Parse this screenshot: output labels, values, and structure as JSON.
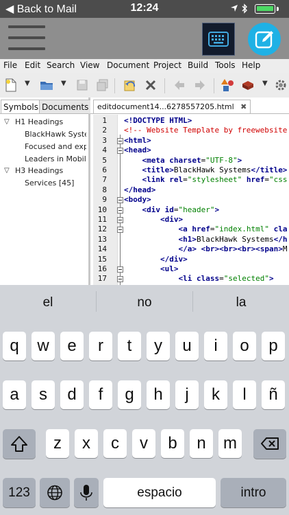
{
  "status": {
    "back": "◀ Back to Mail",
    "time": "12:24"
  },
  "menu": [
    "File",
    "Edit",
    "Search",
    "View",
    "Document",
    "Project",
    "Build",
    "Tools",
    "Help"
  ],
  "sidebar": {
    "tabs": [
      "Symbols",
      "Documents"
    ],
    "tree": [
      {
        "label": "H1 Headings",
        "group": true
      },
      {
        "label": "BlackHawk System",
        "group": false
      },
      {
        "label": "Focused and expe",
        "group": false
      },
      {
        "label": "Leaders in Mobile",
        "group": false
      },
      {
        "label": "H3 Headings",
        "group": true
      },
      {
        "label": "Services [45]",
        "group": false
      }
    ]
  },
  "editor": {
    "tab_title": "editdocument14...6278557205.html",
    "line_numbers": [
      "1",
      "2",
      "3",
      "4",
      "5",
      "6",
      "7",
      "8",
      "9",
      "10",
      "11",
      "12",
      "13",
      "14",
      "15",
      "16",
      "17"
    ],
    "code": [
      [
        [
          "tag",
          "<!DOCTYPE HTML>"
        ]
      ],
      [
        [
          "cmt",
          "<!-- Website Template by freewebsite"
        ]
      ],
      [
        [
          "tag",
          "<html>"
        ]
      ],
      [
        [
          "tag",
          "<head>"
        ]
      ],
      [
        [
          "txt",
          "    "
        ],
        [
          "tag",
          "<meta "
        ],
        [
          "attr",
          "charset"
        ],
        [
          "txt",
          "="
        ],
        [
          "str",
          "\"UTF-8\""
        ],
        [
          "tag",
          ">"
        ]
      ],
      [
        [
          "txt",
          "    "
        ],
        [
          "tag",
          "<title>"
        ],
        [
          "txt",
          "BlackHawk Systems"
        ],
        [
          "tag",
          "</title>"
        ]
      ],
      [
        [
          "txt",
          "    "
        ],
        [
          "tag",
          "<link "
        ],
        [
          "attr",
          "rel"
        ],
        [
          "txt",
          "="
        ],
        [
          "str",
          "\"stylesheet\""
        ],
        [
          "txt",
          " "
        ],
        [
          "attr",
          "href"
        ],
        [
          "txt",
          "="
        ],
        [
          "str",
          "\"css"
        ]
      ],
      [
        [
          "tag",
          "</head>"
        ]
      ],
      [
        [
          "tag",
          "<body>"
        ]
      ],
      [
        [
          "txt",
          "    "
        ],
        [
          "tag",
          "<div "
        ],
        [
          "attr",
          "id"
        ],
        [
          "txt",
          "="
        ],
        [
          "str",
          "\"header\""
        ],
        [
          "tag",
          ">"
        ]
      ],
      [
        [
          "txt",
          "        "
        ],
        [
          "tag",
          "<div>"
        ]
      ],
      [
        [
          "txt",
          "            "
        ],
        [
          "tag",
          "<a "
        ],
        [
          "attr",
          "href"
        ],
        [
          "txt",
          "="
        ],
        [
          "str",
          "\"index.html\""
        ],
        [
          "txt",
          " "
        ],
        [
          "attr",
          "cla"
        ]
      ],
      [
        [
          "txt",
          "            "
        ],
        [
          "tag",
          "<h1>"
        ],
        [
          "txt",
          "BlackHawk Systems"
        ],
        [
          "tag",
          "</h"
        ]
      ],
      [
        [
          "txt",
          "            "
        ],
        [
          "tag",
          "</a>"
        ],
        [
          "txt",
          " "
        ],
        [
          "tag",
          "<br><br><br><span>"
        ],
        [
          "txt",
          "M"
        ]
      ],
      [
        [
          "txt",
          "        "
        ],
        [
          "tag",
          "</div>"
        ]
      ],
      [
        [
          "txt",
          "        "
        ],
        [
          "tag",
          "<ul>"
        ]
      ],
      [
        [
          "txt",
          "            "
        ],
        [
          "tag",
          "<li "
        ],
        [
          "attr",
          "class"
        ],
        [
          "txt",
          "="
        ],
        [
          "str",
          "\"selected\""
        ],
        [
          "tag",
          ">"
        ]
      ]
    ]
  },
  "keyboard": {
    "suggestions": [
      "el",
      "no",
      "la"
    ],
    "row1": [
      "q",
      "w",
      "e",
      "r",
      "t",
      "y",
      "u",
      "i",
      "o",
      "p"
    ],
    "row2": [
      "a",
      "s",
      "d",
      "f",
      "g",
      "h",
      "j",
      "k",
      "l",
      "ñ"
    ],
    "row3": [
      "z",
      "x",
      "c",
      "v",
      "b",
      "n",
      "m"
    ],
    "numbers_label": "123",
    "space_label": "espacio",
    "return_label": "intro"
  },
  "colors": {
    "status_bg": "#4c4c4c",
    "header_bg": "#8e8e8e",
    "edit_btn": "#1fb1e5",
    "kbd_btn": "#121b2c",
    "battery": "#4cd964"
  }
}
